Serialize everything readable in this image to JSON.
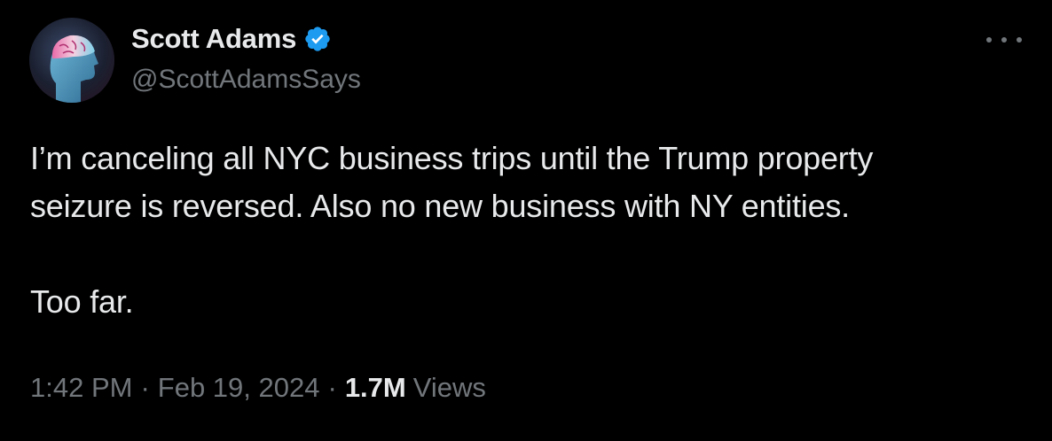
{
  "author": {
    "display_name": "Scott Adams",
    "handle": "@ScottAdamsSays",
    "verified": true,
    "verified_color": "#1d9bf0",
    "avatar_icon": "brain-head-avatar"
  },
  "tweet": {
    "line1": "I’m canceling all NYC business trips until the Trump property",
    "line2": "seizure is reversed. Also no new business with NY entities.",
    "line3": "Too far."
  },
  "meta": {
    "time": "1:42 PM",
    "separator": "·",
    "date": "Feb 19, 2024",
    "views_count": "1.7M",
    "views_label": "Views"
  },
  "more_icon": "more-horizontal-icon"
}
